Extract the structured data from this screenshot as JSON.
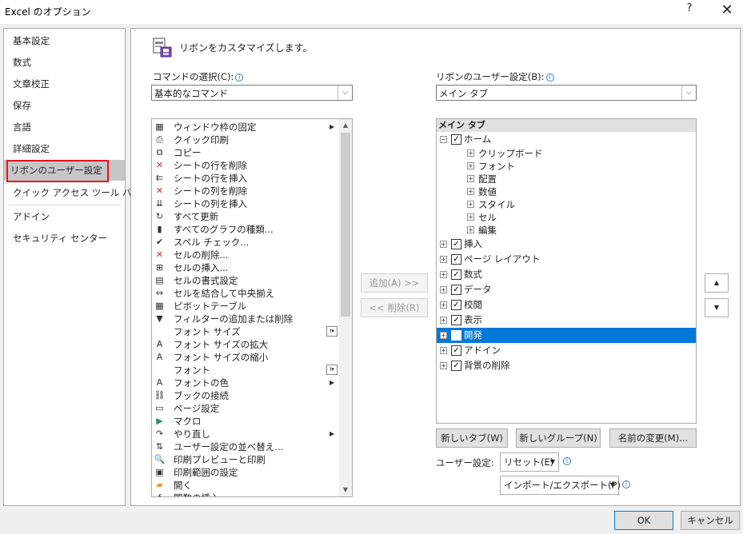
{
  "window": {
    "title": "Excel のオプション",
    "help": "?",
    "close": "✕"
  },
  "sidebar": {
    "items": [
      {
        "label": "基本設定"
      },
      {
        "label": "数式"
      },
      {
        "label": "文章校正"
      },
      {
        "label": "保存"
      },
      {
        "label": "言語"
      },
      {
        "label": "詳細設定"
      },
      {
        "label": "リボンのユーザー設定"
      },
      {
        "label": "クイック アクセス ツール バー"
      },
      {
        "label": "アドイン"
      },
      {
        "label": "セキュリティ センター"
      }
    ],
    "active_index": 6
  },
  "heading": {
    "text": "リボンをカスタマイズします。"
  },
  "left": {
    "label": "コマンドの選択(C):",
    "combo_value": "基本的なコマンド",
    "commands": [
      {
        "label": "ウィンドウ枠の固定",
        "icon": "freeze-panes-icon",
        "glyph": "▦",
        "flag": "submenu"
      },
      {
        "label": "クイック印刷",
        "icon": "quick-print-icon",
        "glyph": "⎙"
      },
      {
        "label": "コピー",
        "icon": "copy-icon",
        "glyph": "⧉"
      },
      {
        "label": "シートの行を削除",
        "icon": "delete-row-icon",
        "glyph": "✕"
      },
      {
        "label": "シートの行を挿入",
        "icon": "insert-row-icon",
        "glyph": "⇇"
      },
      {
        "label": "シートの列を削除",
        "icon": "delete-column-icon",
        "glyph": "✕"
      },
      {
        "label": "シートの列を挿入",
        "icon": "insert-column-icon",
        "glyph": "⇊"
      },
      {
        "label": "すべて更新",
        "icon": "refresh-all-icon",
        "glyph": "↻"
      },
      {
        "label": "すべてのグラフの種類...",
        "icon": "chart-icon",
        "glyph": "▮"
      },
      {
        "label": "スペル チェック...",
        "icon": "spelling-icon",
        "glyph": "✔"
      },
      {
        "label": "セルの削除...",
        "icon": "delete-cell-icon",
        "glyph": "✕"
      },
      {
        "label": "セルの挿入...",
        "icon": "insert-cell-icon",
        "glyph": "⊞"
      },
      {
        "label": "セルの書式設定",
        "icon": "format-cells-icon",
        "glyph": "▤"
      },
      {
        "label": "セルを結合して中央揃え",
        "icon": "merge-center-icon",
        "glyph": "⇔"
      },
      {
        "label": "ピボットテーブル",
        "icon": "pivot-table-icon",
        "glyph": "▦"
      },
      {
        "label": "フィルターの追加または削除",
        "icon": "filter-icon",
        "glyph": "▼"
      },
      {
        "label": "フォント サイズ",
        "icon": "font-size-icon",
        "glyph": "",
        "flag": "dropdown"
      },
      {
        "label": "フォント サイズの拡大",
        "icon": "grow-font-icon",
        "glyph": "A"
      },
      {
        "label": "フォント サイズの縮小",
        "icon": "shrink-font-icon",
        "glyph": "A"
      },
      {
        "label": "フォント",
        "icon": "font-icon",
        "glyph": "",
        "flag": "dropdown"
      },
      {
        "label": "フォントの色",
        "icon": "font-color-icon",
        "glyph": "A",
        "flag": "submenu"
      },
      {
        "label": "ブックの接続",
        "icon": "connections-icon",
        "glyph": "⛓"
      },
      {
        "label": "ページ設定",
        "icon": "page-setup-icon",
        "glyph": "▭"
      },
      {
        "label": "マクロ",
        "icon": "macro-icon",
        "glyph": "▶"
      },
      {
        "label": "やり直し",
        "icon": "redo-icon",
        "glyph": "↷",
        "flag": "submenu"
      },
      {
        "label": "ユーザー設定の並べ替え...",
        "icon": "sort-icon",
        "glyph": "⇅"
      },
      {
        "label": "印刷プレビューと印刷",
        "icon": "print-preview-icon",
        "glyph": "🔍"
      },
      {
        "label": "印刷範囲の設定",
        "icon": "print-area-icon",
        "glyph": "▣"
      },
      {
        "label": "開く",
        "icon": "open-icon",
        "glyph": "▰"
      },
      {
        "label": "関数の挿入...",
        "icon": "insert-function-icon",
        "glyph": "ƒ"
      }
    ]
  },
  "middle": {
    "add_label": "追加(A) >>",
    "remove_label": "<< 削除(R)"
  },
  "right": {
    "label": "リボンのユーザー設定(B):",
    "combo_value": "メイン タブ",
    "tree_header": "メイン タブ",
    "tree": [
      {
        "label": "ホーム",
        "level": 0,
        "expander": "⊟",
        "checked": true
      },
      {
        "label": "クリップボード",
        "level": 1,
        "expander": "⊞"
      },
      {
        "label": "フォント",
        "level": 1,
        "expander": "⊞"
      },
      {
        "label": "配置",
        "level": 1,
        "expander": "⊞"
      },
      {
        "label": "数値",
        "level": 1,
        "expander": "⊞"
      },
      {
        "label": "スタイル",
        "level": 1,
        "expander": "⊞"
      },
      {
        "label": "セル",
        "level": 1,
        "expander": "⊞"
      },
      {
        "label": "編集",
        "level": 1,
        "expander": "⊞"
      },
      {
        "label": "挿入",
        "level": 0,
        "expander": "⊞",
        "checked": true
      },
      {
        "label": "ページ レイアウト",
        "level": 0,
        "expander": "⊞",
        "checked": true
      },
      {
        "label": "数式",
        "level": 0,
        "expander": "⊞",
        "checked": true
      },
      {
        "label": "データ",
        "level": 0,
        "expander": "⊞",
        "checked": true
      },
      {
        "label": "校閲",
        "level": 0,
        "expander": "⊞",
        "checked": true
      },
      {
        "label": "表示",
        "level": 0,
        "expander": "⊞",
        "checked": true
      },
      {
        "label": "開発",
        "level": 0,
        "expander": "⊞",
        "checked": false,
        "selected": true
      },
      {
        "label": "アドイン",
        "level": 0,
        "expander": "⊞",
        "checked": true
      },
      {
        "label": "背景の削除",
        "level": 0,
        "expander": "⊞",
        "checked": true
      }
    ],
    "new_tab_label": "新しいタブ(W)",
    "new_group_label": "新しいグループ(N)",
    "rename_label": "名前の変更(M)...",
    "customizations_label": "ユーザー設定:",
    "reset_label": "リセット(E)",
    "import_export_label": "インポート/エクスポート(P)",
    "move_up": "▲",
    "move_down": "▼"
  },
  "footer": {
    "ok_label": "OK",
    "cancel_label": "キャンセル"
  }
}
